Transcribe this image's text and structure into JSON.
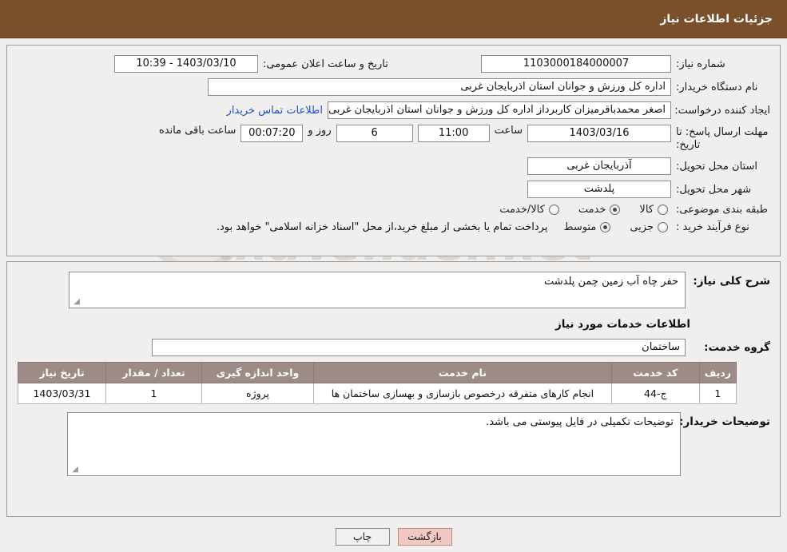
{
  "header": {
    "title": "جزئیات اطلاعات نیاز"
  },
  "watermark": {
    "text": "AnaTender.net"
  },
  "top_form": {
    "need_number_label": "شماره نیاز:",
    "need_number_value": "1103000184000007",
    "announce_date_label": "تاریخ و ساعت اعلان عمومی:",
    "announce_date_value": "1403/03/10 - 10:39",
    "buyer_org_label": "نام دستگاه خریدار:",
    "buyer_org_value": "اداره کل ورزش و جوانان استان اذربایجان غربی",
    "creator_label": "ایجاد کننده درخواست:",
    "creator_value": "اصغر محمدباقرمیزان کاربرداز اداره کل ورزش و جوانان استان اذربایجان غربی",
    "contact_link": "اطلاعات تماس خریدار",
    "deadline_label_line1": "مهلت ارسال پاسخ: تا",
    "deadline_label_line2": "تاریخ:",
    "deadline_date": "1403/03/16",
    "deadline_time_label": "ساعت",
    "deadline_time": "11:00",
    "days_value": "6",
    "days_label": "روز و",
    "remaining_value": "00:07:20",
    "remaining_label": "ساعت باقی مانده",
    "province_label": "استان محل تحویل:",
    "province_value": "آذربایجان غربی",
    "city_label": "شهر محل تحویل:",
    "city_value": "پلدشت",
    "category_label": "طبقه بندی موضوعی:",
    "category_options": [
      {
        "label": "کالا",
        "selected": false
      },
      {
        "label": "خدمت",
        "selected": true
      },
      {
        "label": "کالا/خدمت",
        "selected": false
      }
    ],
    "process_label": "نوع فرآیند خرید :",
    "process_options": [
      {
        "label": "جزیی",
        "selected": false
      },
      {
        "label": "متوسط",
        "selected": true
      }
    ],
    "process_note": "پرداخت تمام یا بخشی از مبلغ خرید،از محل \"اسناد خزانه اسلامی\" خواهد بود."
  },
  "bottom": {
    "general_desc_label": "شرح کلی نیاز:",
    "general_desc_value": "حفر چاه آب زمین چمن پلدشت",
    "services_info_heading": "اطلاعات خدمات مورد نیاز",
    "service_group_label": "گروه خدمت:",
    "service_group_value": "ساختمان",
    "table": {
      "headers": [
        "ردیف",
        "کد خدمت",
        "نام خدمت",
        "واحد اندازه گیری",
        "تعداد / مقدار",
        "تاریخ نیاز"
      ],
      "rows": [
        [
          "1",
          "ج-44",
          "انجام کارهای متفرقه درخصوص بازسازی و بهسازی ساختمان ها",
          "پروژه",
          "1",
          "1403/03/31"
        ]
      ]
    },
    "buyer_notes_label": "توضیحات خریدار:",
    "buyer_notes_value": "توضیحات تکمیلی در فایل پیوستی می باشد."
  },
  "buttons": {
    "print": "چاپ",
    "back": "بازگشت"
  }
}
